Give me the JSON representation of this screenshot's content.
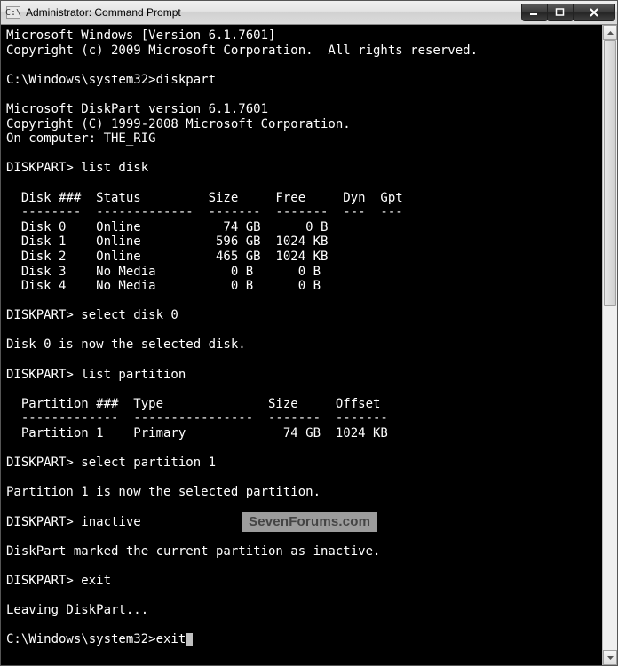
{
  "titlebar": {
    "icon_text": "C:\\",
    "title": "Administrator: Command Prompt"
  },
  "window_controls": {
    "minimize": "minimize",
    "maximize": "maximize",
    "close": "close"
  },
  "scrollbar": {
    "up": "scroll-up",
    "down": "scroll-down",
    "thumb": "scroll-thumb"
  },
  "console": {
    "os_version": "Microsoft Windows [Version 6.1.7601]",
    "os_copyright": "Copyright (c) 2009 Microsoft Corporation.  All rights reserved.",
    "blank1": "",
    "prompt1": "C:\\Windows\\system32>diskpart",
    "blank2": "",
    "dp_version": "Microsoft DiskPart version 6.1.7601",
    "dp_copyright": "Copyright (C) 1999-2008 Microsoft Corporation.",
    "dp_computer": "On computer: THE_RIG",
    "blank3": "",
    "dp_prompt1": "DISKPART> list disk",
    "blank4": "",
    "disk_header": "  Disk ###  Status         Size     Free     Dyn  Gpt",
    "disk_sep": "  --------  -------------  -------  -------  ---  ---",
    "disk0": "  Disk 0    Online           74 GB      0 B",
    "disk1": "  Disk 1    Online          596 GB  1024 KB",
    "disk2": "  Disk 2    Online          465 GB  1024 KB",
    "disk3": "  Disk 3    No Media          0 B      0 B",
    "disk4": "  Disk 4    No Media          0 B      0 B",
    "blank5": "",
    "dp_prompt2": "DISKPART> select disk 0",
    "blank6": "",
    "sel_disk_msg": "Disk 0 is now the selected disk.",
    "blank7": "",
    "dp_prompt3": "DISKPART> list partition",
    "blank8": "",
    "part_header": "  Partition ###  Type              Size     Offset",
    "part_sep": "  -------------  ----------------  -------  -------",
    "part1": "  Partition 1    Primary             74 GB  1024 KB",
    "blank9": "",
    "dp_prompt4": "DISKPART> select partition 1",
    "blank10": "",
    "sel_part_msg": "Partition 1 is now the selected partition.",
    "blank11": "",
    "dp_prompt5": "DISKPART> inactive",
    "blank12": "",
    "inactive_msg": "DiskPart marked the current partition as inactive.",
    "blank13": "",
    "dp_prompt6": "DISKPART> exit",
    "blank14": "",
    "leaving": "Leaving DiskPart...",
    "blank15": "",
    "prompt2": "C:\\Windows\\system32>exit"
  },
  "watermark": {
    "text": "SevenForums.com"
  }
}
